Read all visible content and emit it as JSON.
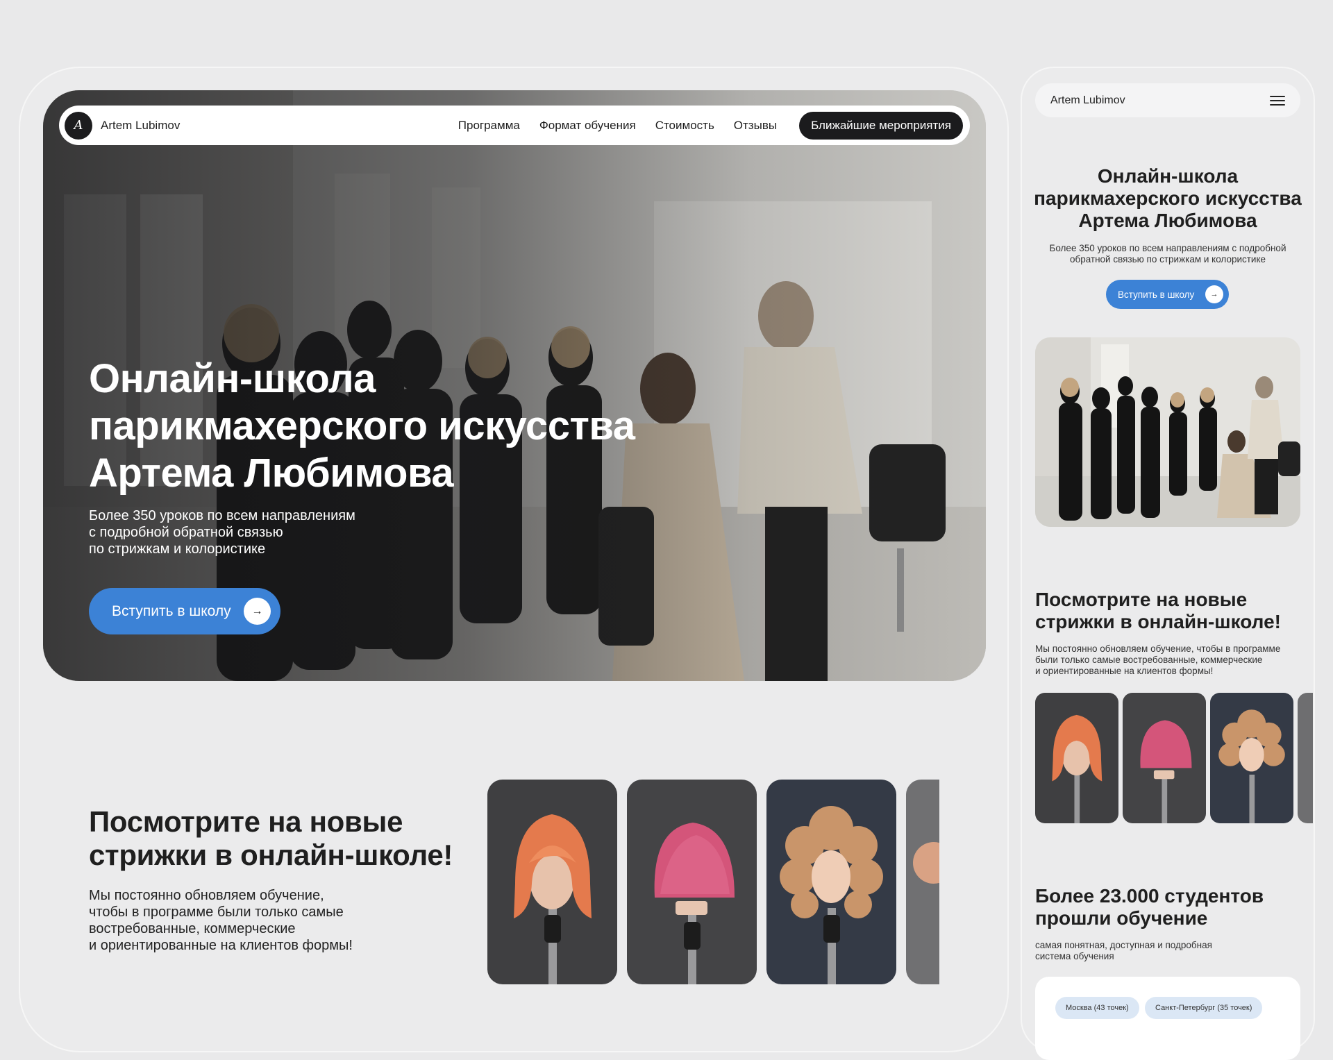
{
  "brand": {
    "name": "Artem Lubimov",
    "logo_glyph": "A"
  },
  "nav": {
    "links": [
      "Программа",
      "Формат обучения",
      "Стоимость",
      "Отзывы"
    ],
    "cta": "Ближайшие мероприятия"
  },
  "hero": {
    "title_lines": [
      "Онлайн-школа",
      "парикмахерского искусства",
      "Артема Любимова"
    ],
    "subtitle_lines": [
      "Более 350 уроков по всем направлениям",
      "с подробной обратной связью",
      "по стрижкам и колористике"
    ],
    "cta": "Вступить в школу",
    "arrow": "→"
  },
  "showcase": {
    "title_lines": [
      "Посмотрите на новые",
      "стрижки в онлайн-школе!"
    ],
    "text_lines": [
      "Мы постоянно обновляем обучение,",
      "чтобы в программе были только самые",
      "востребованные, коммерческие",
      "и ориентированные на клиентов формы!"
    ]
  },
  "mobile": {
    "brand": "Artem Lubimov",
    "menu_icon": "hamburger-icon",
    "title_lines": [
      "Онлайн-школа",
      "парикмахерского искусства",
      "Артема Любимова"
    ],
    "subtitle_lines": [
      "Более 350 уроков по всем направлениям с подробной",
      "обратной связью по стрижкам и колористике"
    ],
    "cta": "Вступить в школу",
    "showcase_title_lines": [
      "Посмотрите на новые",
      "стрижки в онлайн-школе!"
    ],
    "showcase_text_lines": [
      "Мы постоянно обновляем обучение, чтобы в программе",
      "были только самые востребованные, коммерческие",
      "и ориентированные на клиентов формы!"
    ],
    "stats_title_lines": [
      "Более 23.000 студентов",
      "прошли обучение"
    ],
    "stats_sub_lines": [
      "самая понятная, доступная и подробная",
      "система обучения"
    ],
    "chips": [
      "Москва (43 точек)",
      "Санкт-Петербург (35 точек)"
    ]
  },
  "colors": {
    "accent": "#3c82d6",
    "dark": "#1b1b1d",
    "background": "#e9e9ea"
  }
}
